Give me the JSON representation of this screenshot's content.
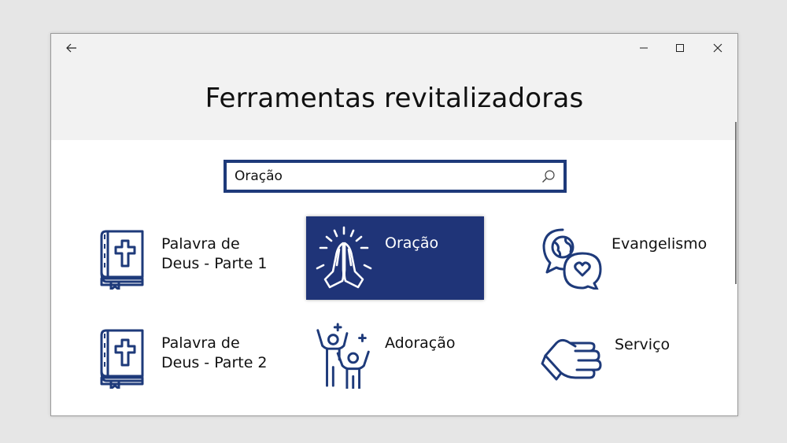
{
  "window": {
    "title": "Ferramentas revitalizadoras"
  },
  "search": {
    "value": "Oração",
    "placeholder": ""
  },
  "tiles": [
    {
      "label": "Palavra de Deus - Parte 1",
      "icon": "bible-icon",
      "selected": false
    },
    {
      "label": "Oração",
      "icon": "praying-hands-icon",
      "selected": true
    },
    {
      "label": "Evangelismo",
      "icon": "speech-bubbles-globe-heart-icon",
      "selected": false
    },
    {
      "label": "Palavra de Deus - Parte 2",
      "icon": "bible-icon",
      "selected": false
    },
    {
      "label": "Adoração",
      "icon": "worship-people-icon",
      "selected": false
    },
    {
      "label": "Serviço",
      "icon": "helping-hand-icon",
      "selected": false
    }
  ],
  "colors": {
    "accent": "#1f3478",
    "icon_stroke": "#1e3a7a",
    "selected_text": "#ffffff"
  }
}
